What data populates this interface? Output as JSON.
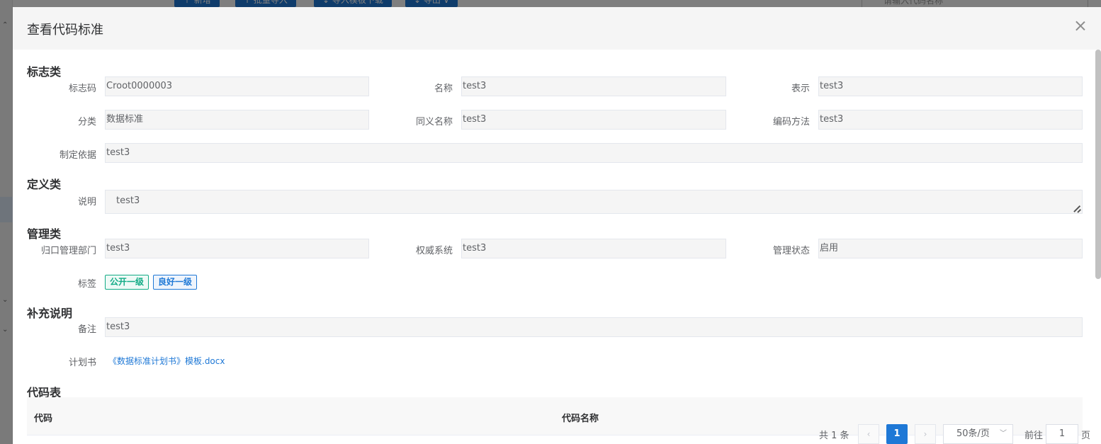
{
  "background": {
    "toolbar_buttons": [
      "＋ 新增",
      "↑ 批量导入",
      "↓ 导入模板下载",
      "↓ 导出 ∨"
    ],
    "search_placeholder": "请输入代码名称"
  },
  "dialog": {
    "title": "查看代码标准",
    "sections": {
      "identity": "标志类",
      "definition": "定义类",
      "management": "管理类",
      "supplement": "补充说明",
      "code_table": "代码表"
    },
    "fields": {
      "code_label": "标志码",
      "code_value": "Croot0000003",
      "name_label": "名称",
      "name_value": "test3",
      "repr_label": "表示",
      "repr_value": "test3",
      "category_label": "分类",
      "category_value": "数据标准",
      "synonym_label": "同义名称",
      "synonym_value": "test3",
      "encoding_label": "编码方法",
      "encoding_value": "test3",
      "basis_label": "制定依据",
      "basis_value": "test3",
      "desc_label": "说明",
      "desc_value": "test3",
      "dept_label": "归口管理部门",
      "dept_value": "test3",
      "authority_label": "权威系统",
      "authority_value": "test3",
      "status_label": "管理状态",
      "status_value": "启用",
      "tags_label": "标签",
      "remark_label": "备注",
      "remark_value": "test3",
      "plan_label": "计划书",
      "plan_file": "《数据标准计划书》模板.docx"
    },
    "tags": [
      "公开一级",
      "良好一级"
    ],
    "table": {
      "columns": [
        "代码",
        "代码名称"
      ]
    },
    "pagination": {
      "total": "共 1 条",
      "prev": "‹",
      "current_page": "1",
      "next": "›",
      "page_size": "50条/页",
      "goto_label": "前往",
      "goto_value": "1",
      "page_unit": "页"
    }
  }
}
